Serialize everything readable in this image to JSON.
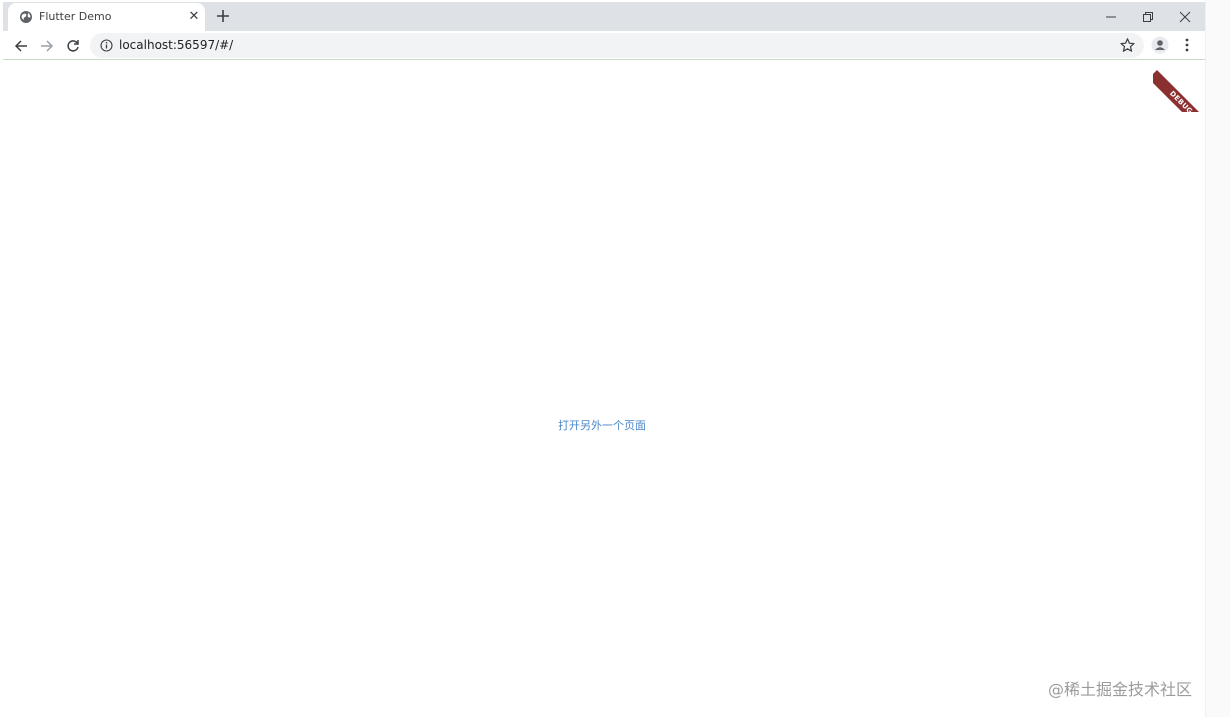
{
  "browser": {
    "tab": {
      "title": "Flutter Demo",
      "favicon": "globe-icon",
      "close": "✕"
    },
    "new_tab_icon": "plus-icon",
    "window_controls": [
      "minimize-icon",
      "restore-icon",
      "close-icon"
    ],
    "toolbar": {
      "back_icon": "arrow-left-icon",
      "forward_icon": "arrow-right-icon",
      "reload_icon": "reload-icon",
      "url": "localhost:56597/#/",
      "info_icon": "info-icon",
      "bookmark_icon": "star-icon",
      "profile_icon": "avatar-icon",
      "menu_icon": "kebab-menu-icon"
    }
  },
  "page": {
    "link_text": "打开另外一个页面",
    "link_color": "#4a86c8",
    "debug_banner": "DEBUG",
    "debug_color": "#8b3030"
  },
  "watermark": "@稀土掘金技术社区"
}
